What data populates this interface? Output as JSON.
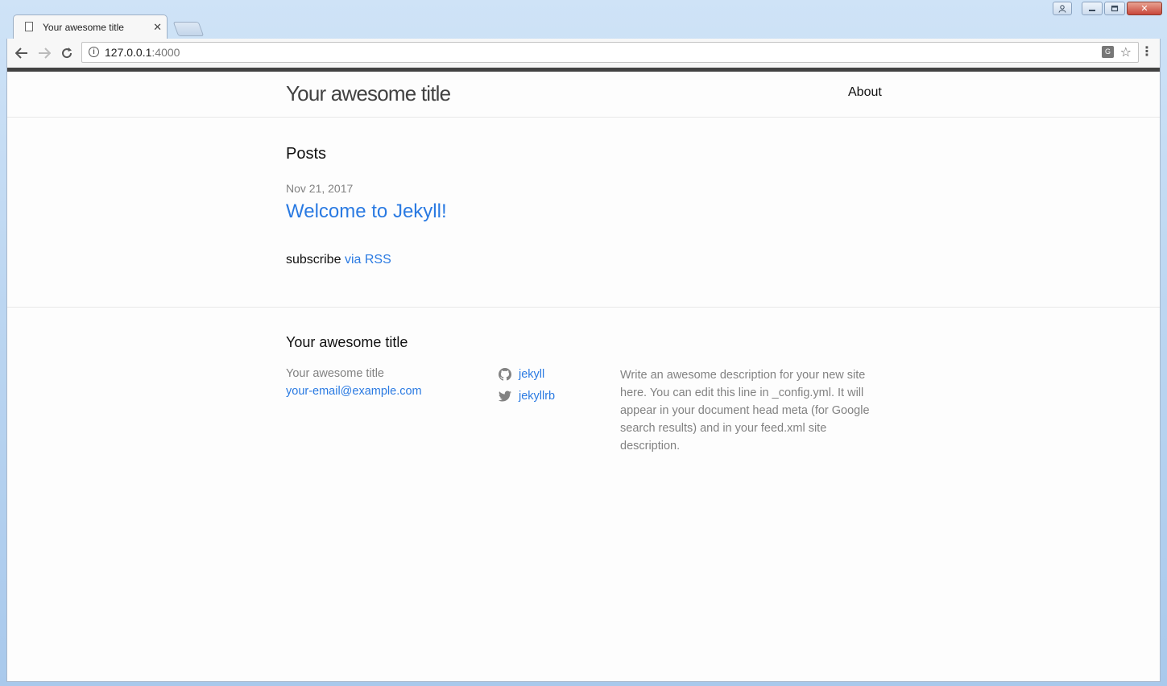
{
  "browser": {
    "tab_title": "Your awesome title",
    "url_host": "127.0.0.1",
    "url_port": ":4000"
  },
  "site": {
    "title": "Your awesome title",
    "nav": {
      "about": "About"
    }
  },
  "posts": {
    "heading": "Posts",
    "items": [
      {
        "date": "Nov 21, 2017",
        "title": "Welcome to Jekyll!"
      }
    ],
    "subscribe_text": "subscribe",
    "rss_link": "via RSS"
  },
  "footer": {
    "heading": "Your awesome title",
    "name": "Your awesome title",
    "email": "your-email@example.com",
    "github": "jekyll",
    "twitter": "jekyllrb",
    "description": "Write an awesome description for your new site here. You can edit this line in _config.yml. It will appear in your document head meta (for Google search results) and in your feed.xml site description."
  },
  "colors": {
    "link": "#2a7ae2",
    "text": "#111111",
    "meta": "#828282",
    "header_bar": "#424242"
  },
  "icons": [
    "document-icon",
    "close-icon",
    "back-icon",
    "forward-icon",
    "reload-icon",
    "info-icon",
    "translate-icon",
    "star-icon",
    "menu-icon",
    "github-icon",
    "twitter-icon",
    "user-icon",
    "minimize-icon",
    "maximize-icon"
  ]
}
